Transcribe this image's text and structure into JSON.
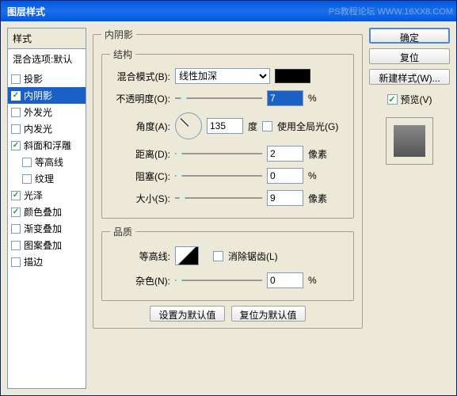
{
  "titlebar": {
    "title": "图层样式",
    "watermark": "PS教程论坛 WWW.16XX8.COM"
  },
  "styles": {
    "header": "样式",
    "blending": "混合选项:默认",
    "items": [
      {
        "label": "投影",
        "checked": false
      },
      {
        "label": "内阴影",
        "checked": true,
        "selected": true
      },
      {
        "label": "外发光",
        "checked": false
      },
      {
        "label": "内发光",
        "checked": false
      },
      {
        "label": "斜面和浮雕",
        "checked": true
      },
      {
        "label": "等高线",
        "checked": false,
        "sub": true
      },
      {
        "label": "纹理",
        "checked": false,
        "sub": true
      },
      {
        "label": "光泽",
        "checked": true
      },
      {
        "label": "颜色叠加",
        "checked": true
      },
      {
        "label": "渐变叠加",
        "checked": false
      },
      {
        "label": "图案叠加",
        "checked": false
      },
      {
        "label": "描边",
        "checked": false
      }
    ]
  },
  "main": {
    "section_title": "内阴影",
    "structure": {
      "legend": "结构",
      "blend_mode": {
        "label": "混合模式(B):",
        "value": "线性加深"
      },
      "opacity": {
        "label": "不透明度(O):",
        "value": "7",
        "unit": "%"
      },
      "angle": {
        "label": "角度(A):",
        "value": "135",
        "unit": "度"
      },
      "global_light": {
        "label": "使用全局光(G)",
        "checked": false
      },
      "distance": {
        "label": "距离(D):",
        "value": "2",
        "unit": "像素"
      },
      "choke": {
        "label": "阻塞(C):",
        "value": "0",
        "unit": "%"
      },
      "size": {
        "label": "大小(S):",
        "value": "9",
        "unit": "像素"
      }
    },
    "quality": {
      "legend": "品质",
      "contour": "等高线:",
      "antialias": {
        "label": "消除锯齿(L)",
        "checked": false
      },
      "noise": {
        "label": "杂色(N):",
        "value": "0",
        "unit": "%"
      }
    },
    "buttons": {
      "make_default": "设置为默认值",
      "reset_default": "复位为默认值"
    }
  },
  "right": {
    "ok": "确定",
    "cancel": "复位",
    "new_style": "新建样式(W)...",
    "preview": {
      "label": "预览(V)",
      "checked": true
    }
  }
}
